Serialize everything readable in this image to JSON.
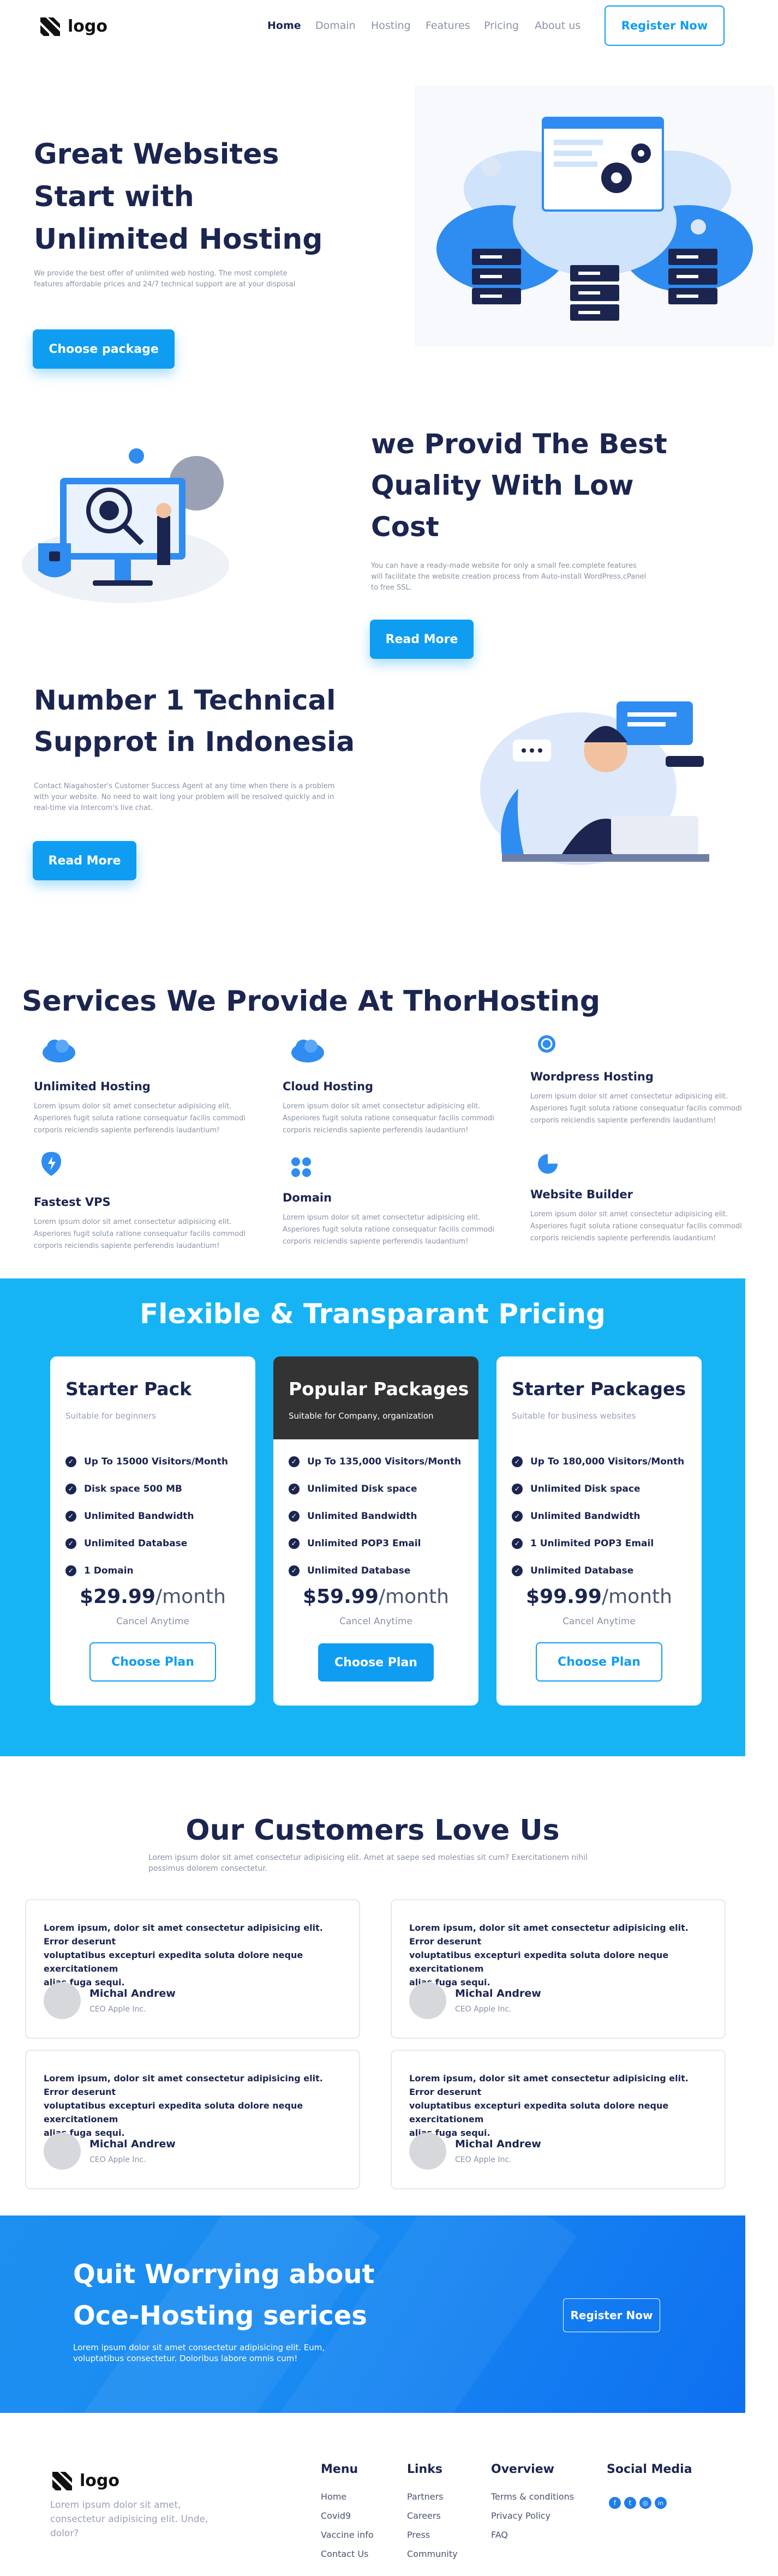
{
  "brand": {
    "logo_text": "logo",
    "accent": "#0f9df2",
    "dark": "#1b2550"
  },
  "nav": {
    "items": [
      "Home",
      "Domain",
      "Hosting",
      "Features",
      "Pricing",
      "About us"
    ],
    "register": "Register Now"
  },
  "hero": {
    "title_lines": [
      "Great Websites",
      "Start with",
      "Unlimited Hosting"
    ],
    "text_lines": [
      "We provide the best offer of unlimited web hosting. The most complete",
      "features affordable prices and 24/7 technical support are at your disposal"
    ],
    "button": "Choose package"
  },
  "quality": {
    "title_lines": [
      "we Provid The Best",
      "Quality With Low",
      "Cost"
    ],
    "text_lines": [
      "You can have a ready-made website for only a small fee.complete features",
      "will facilitate the website creation process from Auto-install WordPress,cPanel",
      "to free SSL."
    ],
    "button": "Read More"
  },
  "support": {
    "title_lines": [
      "Number 1 Technical",
      "Supprot in Indonesia"
    ],
    "text_lines": [
      "Contact Niagahoster's Customer Success Agent at any time when there is a problem",
      "with your website. No need to wait long your problem will be resolved quickly and in",
      "real-time via Intercom's live chat."
    ],
    "button": "Read More"
  },
  "services": {
    "heading": "Services We Provide At ThorHosting",
    "desc_lines": [
      "Lorem ipsum dolor sit amet consectetur adipisicing elit.",
      "Asperiores fugit soluta ratione consequatur facilis commodi",
      "corporis reiciendis sapiente perferendis laudantium!"
    ],
    "items": [
      {
        "title": "Unlimited Hosting",
        "icon": "cloud-icon"
      },
      {
        "title": "Cloud Hosting",
        "icon": "cloud-icon"
      },
      {
        "title": "Wordpress Hosting",
        "icon": "wordpress-icon"
      },
      {
        "title": "Fastest VPS",
        "icon": "lightning-icon"
      },
      {
        "title": "Domain",
        "icon": "grid-dots-icon"
      },
      {
        "title": "Website Builder",
        "icon": "pie-icon"
      }
    ]
  },
  "pricing": {
    "heading": "Flexible & Transparant Pricing",
    "cancel": "Cancel Anytime",
    "button": "Choose Plan",
    "plans": [
      {
        "title": "Starter Pack",
        "subtitle": "Suitable for beginners",
        "features": [
          "Up To 15000 Visitors/Month",
          "Disk space 500 MB",
          "Unlimited Bandwidth",
          "Unlimited Database",
          "1 Domain"
        ],
        "price": "$29.99",
        "period": "/month"
      },
      {
        "title": "Popular Packages",
        "subtitle": "Suitable for Company, organization",
        "features": [
          "Up To 135,000 Visitors/Month",
          "Unlimited Disk space",
          "Unlimited Bandwidth",
          "Unlimited POP3 Email",
          "Unlimited Database"
        ],
        "price": "$59.99",
        "period": "/month"
      },
      {
        "title": "Starter Packages",
        "subtitle": "Suitable for business websites",
        "features": [
          "Up To 180,000 Visitors/Month",
          "Unlimited Disk space",
          "Unlimited Bandwidth",
          "1 Unlimited POP3 Email",
          "Unlimited Database"
        ],
        "price": "$99.99",
        "period": "/month"
      }
    ]
  },
  "testimonials": {
    "heading": "Our Customers Love Us",
    "intro_lines": [
      "Lorem ipsum dolor sit amet consectetur adipisicing elit. Amet at saepe sed molestias sit cum? Exercitationem nihil",
      "possimus dolorem consectetur."
    ],
    "quote_lines": [
      "Lorem ipsum, dolor sit amet consectetur adipisicing elit. Error deserunt",
      "voluptatibus excepturi expedita soluta dolore neque exercitationem",
      "alias fuga sequi."
    ],
    "name": "Michal Andrew",
    "role": "CEO Apple Inc."
  },
  "cta": {
    "title_lines": [
      "Quit Worrying about",
      "Oce-Hosting serices"
    ],
    "text_lines": [
      "Lorem ipsum dolor sit amet consectetur adipisicing elit. Eum,",
      "voluptatibus consectetur. Doloribus labore omnis cum!"
    ],
    "button": "Register Now"
  },
  "footer": {
    "about_lines": [
      "Lorem ipsum dolor sit amet,",
      "consectetur adipisicing elit. Unde,",
      "dolor?"
    ],
    "menu": {
      "title": "Menu",
      "links": [
        "Home",
        "Covid9",
        "Vaccine info",
        "Contact Us"
      ]
    },
    "links": {
      "title": "Links",
      "links": [
        "Partners",
        "Careers",
        "Press",
        "Community"
      ]
    },
    "overview": {
      "title": "Overview",
      "links": [
        "Terms & conditions",
        "Privacy Policy",
        "FAQ"
      ]
    },
    "social": {
      "title": "Social Media",
      "icons": [
        "facebook-icon",
        "twitter-icon",
        "instagram-icon",
        "linkedin-icon"
      ]
    }
  }
}
